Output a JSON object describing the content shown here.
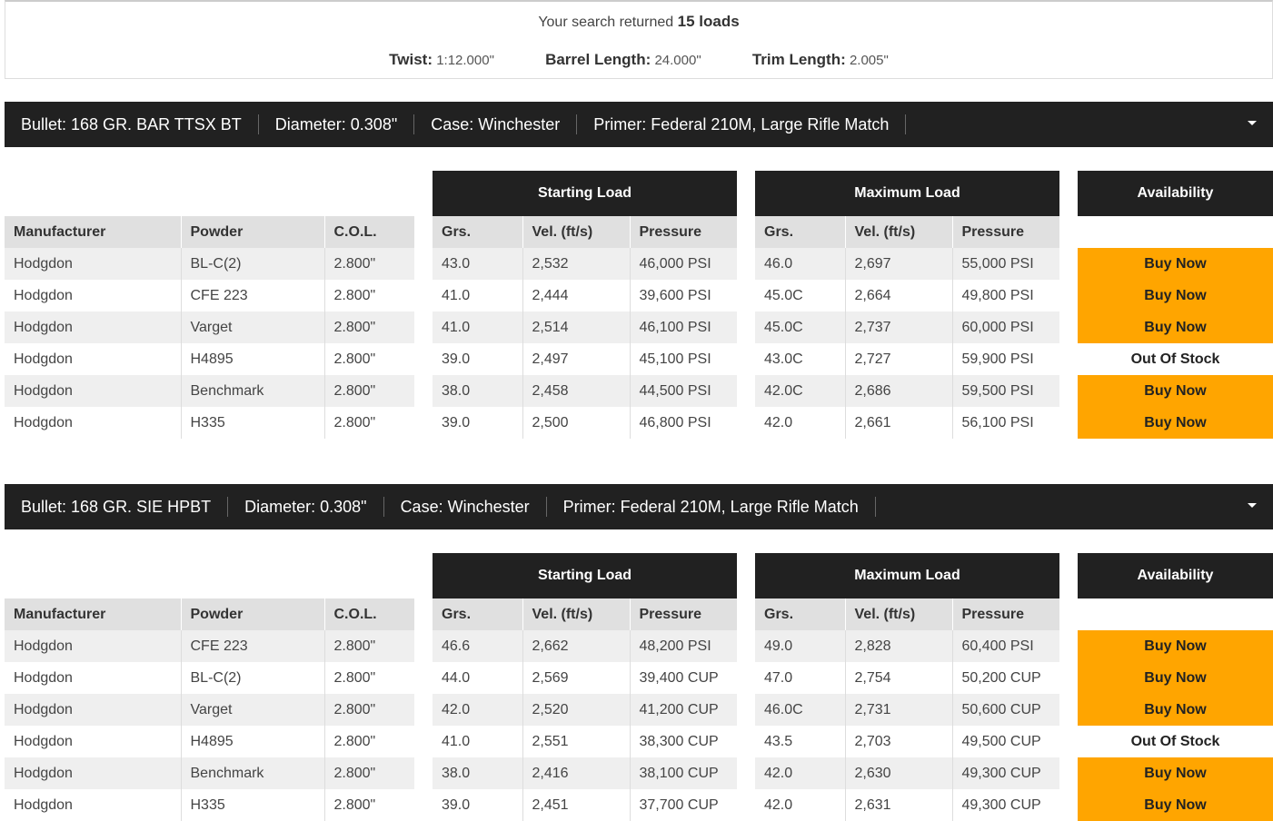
{
  "summary": {
    "prefix": "Your search returned",
    "count": "15 loads",
    "specs": [
      {
        "label": "Twist:",
        "value": "1:12.000\""
      },
      {
        "label": "Barrel Length:",
        "value": "24.000\""
      },
      {
        "label": "Trim Length:",
        "value": "2.005\""
      }
    ]
  },
  "headers": {
    "starting": "Starting Load",
    "maximum": "Maximum Load",
    "availability": "Availability",
    "left_cols": [
      "Manufacturer",
      "Powder",
      "C.O.L."
    ],
    "load_cols": [
      "Grs.",
      "Vel. (ft/s)",
      "Pressure"
    ]
  },
  "groups": [
    {
      "bar": [
        "Bullet: 168 GR. BAR TTSX BT",
        "Diameter: 0.308\"",
        "Case: Winchester",
        "Primer: Federal 210M, Large Rifle Match"
      ],
      "rows": [
        {
          "mfr": "Hodgdon",
          "powder": "BL-C(2)",
          "col": "2.800\"",
          "s_grs": "43.0",
          "s_vel": "2,532",
          "s_pres": "46,000 PSI",
          "m_grs": "46.0",
          "m_vel": "2,697",
          "m_pres": "55,000 PSI",
          "avail": "Buy Now",
          "buy": true
        },
        {
          "mfr": "Hodgdon",
          "powder": "CFE 223",
          "col": "2.800\"",
          "s_grs": "41.0",
          "s_vel": "2,444",
          "s_pres": "39,600 PSI",
          "m_grs": "45.0C",
          "m_vel": "2,664",
          "m_pres": "49,800 PSI",
          "avail": "Buy Now",
          "buy": true
        },
        {
          "mfr": "Hodgdon",
          "powder": "Varget",
          "col": "2.800\"",
          "s_grs": "41.0",
          "s_vel": "2,514",
          "s_pres": "46,100 PSI",
          "m_grs": "45.0C",
          "m_vel": "2,737",
          "m_pres": "60,000 PSI",
          "avail": "Buy Now",
          "buy": true
        },
        {
          "mfr": "Hodgdon",
          "powder": "H4895",
          "col": "2.800\"",
          "s_grs": "39.0",
          "s_vel": "2,497",
          "s_pres": "45,100 PSI",
          "m_grs": "43.0C",
          "m_vel": "2,727",
          "m_pres": "59,900 PSI",
          "avail": "Out Of Stock",
          "buy": false
        },
        {
          "mfr": "Hodgdon",
          "powder": "Benchmark",
          "col": "2.800\"",
          "s_grs": "38.0",
          "s_vel": "2,458",
          "s_pres": "44,500 PSI",
          "m_grs": "42.0C",
          "m_vel": "2,686",
          "m_pres": "59,500 PSI",
          "avail": "Buy Now",
          "buy": true
        },
        {
          "mfr": "Hodgdon",
          "powder": "H335",
          "col": "2.800\"",
          "s_grs": "39.0",
          "s_vel": "2,500",
          "s_pres": "46,800 PSI",
          "m_grs": "42.0",
          "m_vel": "2,661",
          "m_pres": "56,100 PSI",
          "avail": "Buy Now",
          "buy": true
        }
      ]
    },
    {
      "bar": [
        "Bullet: 168 GR. SIE HPBT",
        "Diameter: 0.308\"",
        "Case: Winchester",
        "Primer: Federal 210M, Large Rifle Match"
      ],
      "rows": [
        {
          "mfr": "Hodgdon",
          "powder": "CFE 223",
          "col": "2.800\"",
          "s_grs": "46.6",
          "s_vel": "2,662",
          "s_pres": "48,200 PSI",
          "m_grs": "49.0",
          "m_vel": "2,828",
          "m_pres": "60,400 PSI",
          "avail": "Buy Now",
          "buy": true
        },
        {
          "mfr": "Hodgdon",
          "powder": "BL-C(2)",
          "col": "2.800\"",
          "s_grs": "44.0",
          "s_vel": "2,569",
          "s_pres": "39,400 CUP",
          "m_grs": "47.0",
          "m_vel": "2,754",
          "m_pres": "50,200 CUP",
          "avail": "Buy Now",
          "buy": true
        },
        {
          "mfr": "Hodgdon",
          "powder": "Varget",
          "col": "2.800\"",
          "s_grs": "42.0",
          "s_vel": "2,520",
          "s_pres": "41,200 CUP",
          "m_grs": "46.0C",
          "m_vel": "2,731",
          "m_pres": "50,600 CUP",
          "avail": "Buy Now",
          "buy": true
        },
        {
          "mfr": "Hodgdon",
          "powder": "H4895",
          "col": "2.800\"",
          "s_grs": "41.0",
          "s_vel": "2,551",
          "s_pres": "38,300 CUP",
          "m_grs": "43.5",
          "m_vel": "2,703",
          "m_pres": "49,500 CUP",
          "avail": "Out Of Stock",
          "buy": false
        },
        {
          "mfr": "Hodgdon",
          "powder": "Benchmark",
          "col": "2.800\"",
          "s_grs": "38.0",
          "s_vel": "2,416",
          "s_pres": "38,100 CUP",
          "m_grs": "42.0",
          "m_vel": "2,630",
          "m_pres": "49,300 CUP",
          "avail": "Buy Now",
          "buy": true
        },
        {
          "mfr": "Hodgdon",
          "powder": "H335",
          "col": "2.800\"",
          "s_grs": "39.0",
          "s_vel": "2,451",
          "s_pres": "37,700 CUP",
          "m_grs": "42.0",
          "m_vel": "2,631",
          "m_pres": "49,300 CUP",
          "avail": "Buy Now",
          "buy": true
        }
      ]
    }
  ],
  "colors": {
    "buy_button": "#ffa500",
    "header_bar": "#212121",
    "col_header": "#e0e0e0",
    "row_stripe": "#efefef"
  }
}
